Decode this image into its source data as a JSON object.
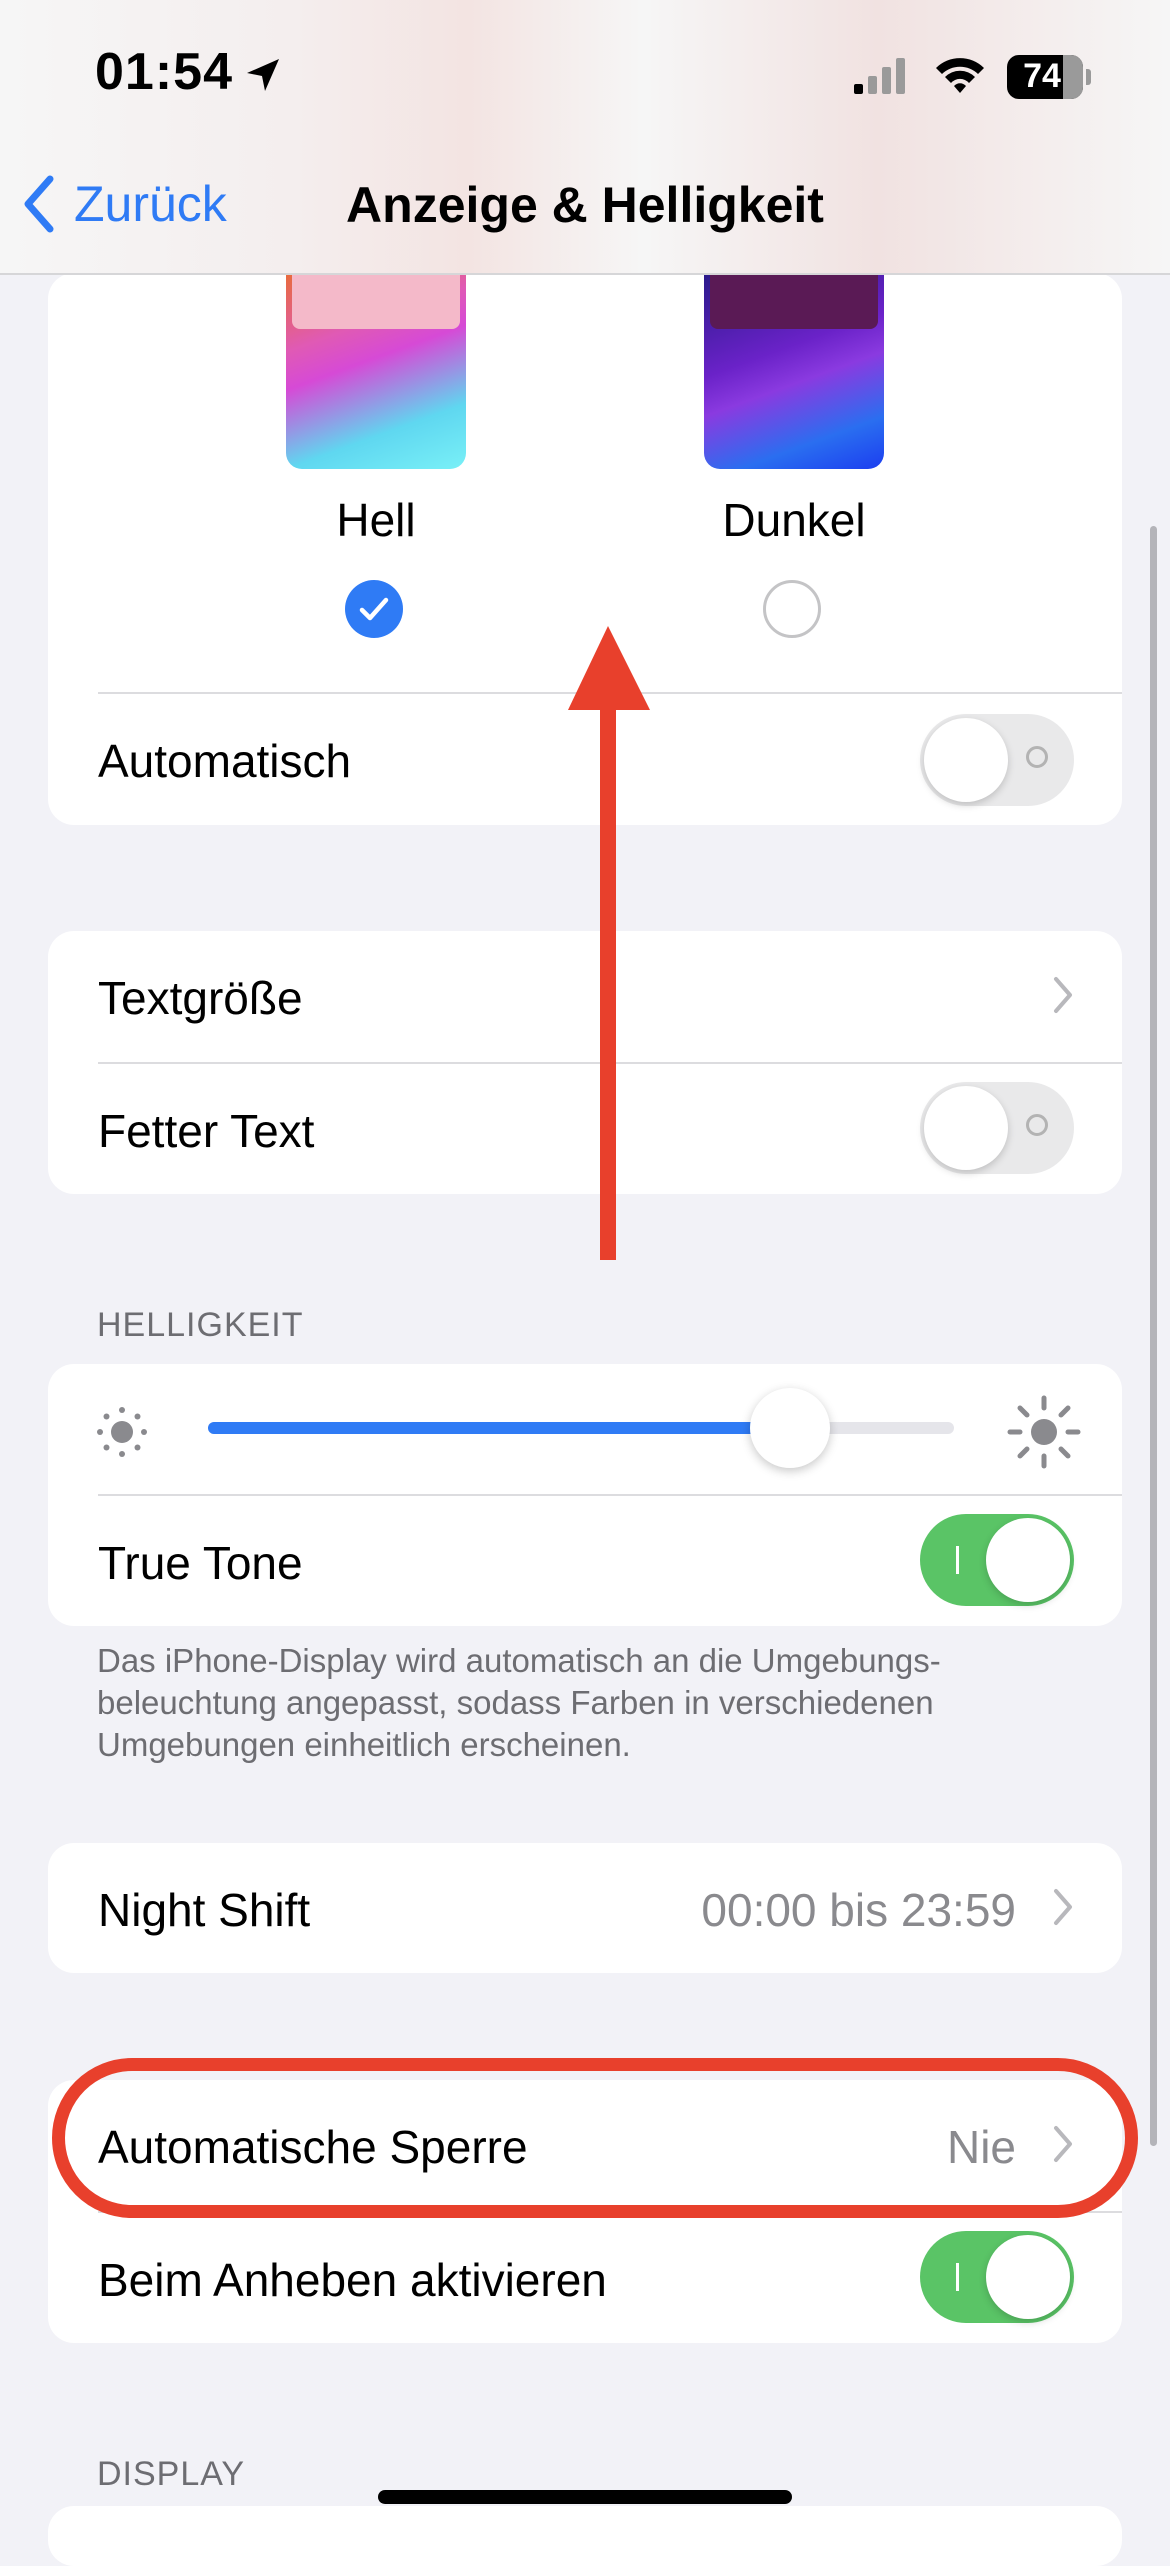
{
  "status_bar": {
    "time": "01:54",
    "battery_percent": "74",
    "icons": [
      "location-arrow-icon",
      "cellular-signal-icon",
      "wifi-icon",
      "battery-icon"
    ]
  },
  "nav": {
    "back_label": "Zurück",
    "title": "Anzeige & Helligkeit"
  },
  "appearance": {
    "options": [
      {
        "label": "Hell",
        "selected": true
      },
      {
        "label": "Dunkel",
        "selected": false
      }
    ],
    "automatic": {
      "label": "Automatisch",
      "on": false
    }
  },
  "text_settings": {
    "text_size_label": "Textgröße",
    "bold_text": {
      "label": "Fetter Text",
      "on": false
    }
  },
  "brightness": {
    "header": "HELLIGKEIT",
    "level": 0.78,
    "true_tone": {
      "label": "True Tone",
      "on": true
    },
    "footnote": "Das iPhone-Display wird automatisch an die Umgebungs­beleuchtung angepasst, sodass Farben in verschiedenen Umgebungen einheitlich erscheinen."
  },
  "night_shift": {
    "label": "Night Shift",
    "value": "00:00 bis 23:59"
  },
  "lock": {
    "auto_lock": {
      "label": "Automatische Sperre",
      "value": "Nie"
    },
    "raise_to_wake": {
      "label": "Beim Anheben aktivieren",
      "on": true
    }
  },
  "display_section": {
    "header": "DISPLAY"
  },
  "colors": {
    "accent": "#2f7bf5",
    "toggle_on": "#5ac466",
    "annotation": "#e8402c"
  }
}
